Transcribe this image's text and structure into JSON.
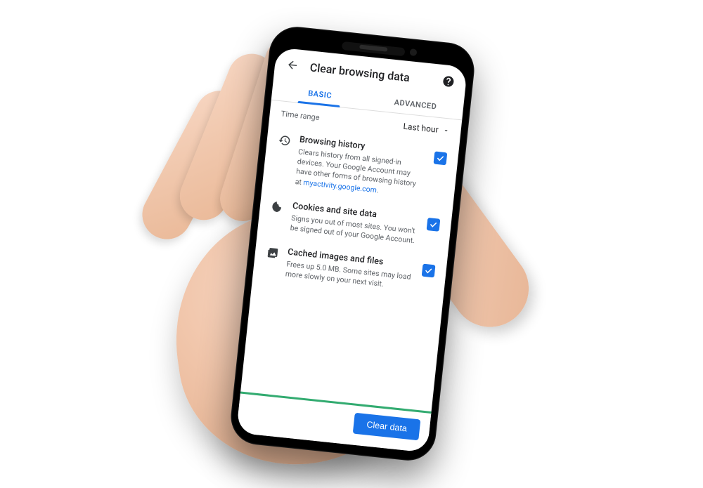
{
  "header": {
    "title": "Clear browsing data"
  },
  "tabs": {
    "basic": "BASIC",
    "advanced": "ADVANCED"
  },
  "time_range": {
    "label": "Time range",
    "selected": "Last hour"
  },
  "options": {
    "history": {
      "title": "Browsing history",
      "desc_pre": "Clears history from all signed-in devices. Your Google Account may have other forms of browsing history at ",
      "link_text": "myactivity.google.com",
      "desc_post": "."
    },
    "cookies": {
      "title": "Cookies and site data",
      "desc": "Signs you out of most sites. You won't be signed out of your Google Account."
    },
    "cache": {
      "title": "Cached images and files",
      "desc": "Frees up 5.0 MB. Some sites may load more slowly on your next visit."
    }
  },
  "footer": {
    "clear": "Clear data"
  }
}
